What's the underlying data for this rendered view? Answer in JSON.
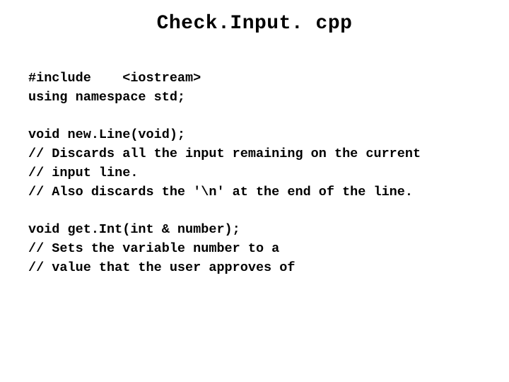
{
  "title": "Check.Input. cpp",
  "code": {
    "l1": "#include    <iostream>",
    "l2": "using namespace std;",
    "l3": "",
    "l4": "void new.Line(void);",
    "l5": "// Discards all the input remaining on the current",
    "l6": "// input line.",
    "l7": "// Also discards the '\\n' at the end of the line.",
    "l8": "",
    "l9": "void get.Int(int & number);",
    "l10": "// Sets the variable number to a",
    "l11": "// value that the user approves of"
  }
}
